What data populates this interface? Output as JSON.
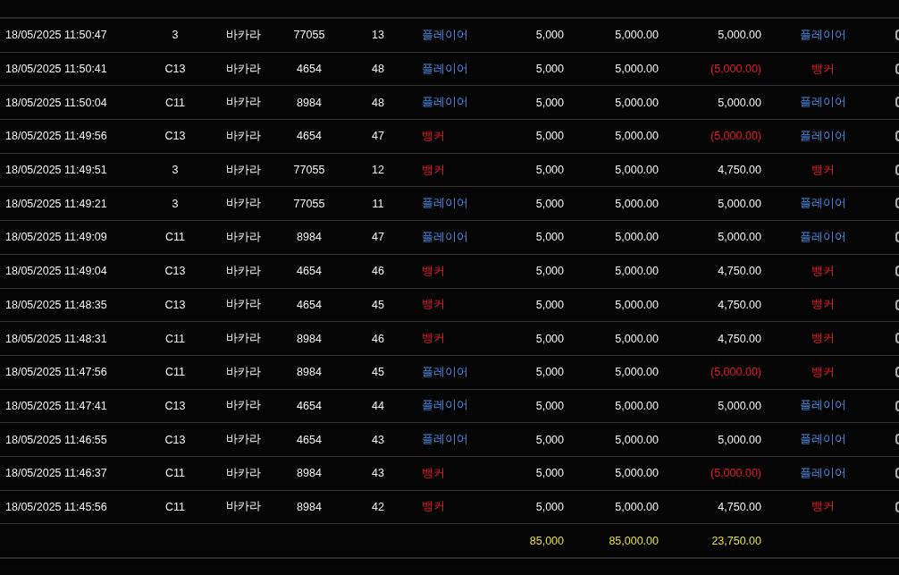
{
  "rows": [
    {
      "time": "18/05/2025 11:50:47",
      "table": "3",
      "game": "바카라",
      "round": "77055",
      "shoe": "13",
      "bet": {
        "text": "플레이어",
        "kind": "player"
      },
      "stake": "5,000",
      "valid": "5,000.00",
      "payout": "5,000.00",
      "loss": false,
      "result": {
        "text": "플레이어",
        "kind": "player"
      }
    },
    {
      "time": "18/05/2025 11:50:41",
      "table": "C13",
      "game": "바카라",
      "round": "4654",
      "shoe": "48",
      "bet": {
        "text": "플레이어",
        "kind": "player"
      },
      "stake": "5,000",
      "valid": "5,000.00",
      "payout": "(5,000.00)",
      "loss": true,
      "result": {
        "text": "뱅커",
        "kind": "banker"
      }
    },
    {
      "time": "18/05/2025 11:50:04",
      "table": "C11",
      "game": "바카라",
      "round": "8984",
      "shoe": "48",
      "bet": {
        "text": "플레이어",
        "kind": "player"
      },
      "stake": "5,000",
      "valid": "5,000.00",
      "payout": "5,000.00",
      "loss": false,
      "result": {
        "text": "플레이어",
        "kind": "player"
      }
    },
    {
      "time": "18/05/2025 11:49:56",
      "table": "C13",
      "game": "바카라",
      "round": "4654",
      "shoe": "47",
      "bet": {
        "text": "뱅커",
        "kind": "banker"
      },
      "stake": "5,000",
      "valid": "5,000.00",
      "payout": "(5,000.00)",
      "loss": true,
      "result": {
        "text": "플레이어",
        "kind": "player"
      }
    },
    {
      "time": "18/05/2025 11:49:51",
      "table": "3",
      "game": "바카라",
      "round": "77055",
      "shoe": "12",
      "bet": {
        "text": "뱅커",
        "kind": "banker"
      },
      "stake": "5,000",
      "valid": "5,000.00",
      "payout": "4,750.00",
      "loss": false,
      "result": {
        "text": "뱅커",
        "kind": "banker"
      }
    },
    {
      "time": "18/05/2025 11:49:21",
      "table": "3",
      "game": "바카라",
      "round": "77055",
      "shoe": "11",
      "bet": {
        "text": "플레이어",
        "kind": "player"
      },
      "stake": "5,000",
      "valid": "5,000.00",
      "payout": "5,000.00",
      "loss": false,
      "result": {
        "text": "플레이어",
        "kind": "player"
      }
    },
    {
      "time": "18/05/2025 11:49:09",
      "table": "C11",
      "game": "바카라",
      "round": "8984",
      "shoe": "47",
      "bet": {
        "text": "플레이어",
        "kind": "player"
      },
      "stake": "5,000",
      "valid": "5,000.00",
      "payout": "5,000.00",
      "loss": false,
      "result": {
        "text": "플레이어",
        "kind": "player"
      }
    },
    {
      "time": "18/05/2025 11:49:04",
      "table": "C13",
      "game": "바카라",
      "round": "4654",
      "shoe": "46",
      "bet": {
        "text": "뱅커",
        "kind": "banker"
      },
      "stake": "5,000",
      "valid": "5,000.00",
      "payout": "4,750.00",
      "loss": false,
      "result": {
        "text": "뱅커",
        "kind": "banker"
      }
    },
    {
      "time": "18/05/2025 11:48:35",
      "table": "C13",
      "game": "바카라",
      "round": "4654",
      "shoe": "45",
      "bet": {
        "text": "뱅커",
        "kind": "banker"
      },
      "stake": "5,000",
      "valid": "5,000.00",
      "payout": "4,750.00",
      "loss": false,
      "result": {
        "text": "뱅커",
        "kind": "banker"
      }
    },
    {
      "time": "18/05/2025 11:48:31",
      "table": "C11",
      "game": "바카라",
      "round": "8984",
      "shoe": "46",
      "bet": {
        "text": "뱅커",
        "kind": "banker"
      },
      "stake": "5,000",
      "valid": "5,000.00",
      "payout": "4,750.00",
      "loss": false,
      "result": {
        "text": "뱅커",
        "kind": "banker"
      }
    },
    {
      "time": "18/05/2025 11:47:56",
      "table": "C11",
      "game": "바카라",
      "round": "8984",
      "shoe": "45",
      "bet": {
        "text": "플레이어",
        "kind": "player"
      },
      "stake": "5,000",
      "valid": "5,000.00",
      "payout": "(5,000.00)",
      "loss": true,
      "result": {
        "text": "뱅커",
        "kind": "banker"
      }
    },
    {
      "time": "18/05/2025 11:47:41",
      "table": "C13",
      "game": "바카라",
      "round": "4654",
      "shoe": "44",
      "bet": {
        "text": "플레이어",
        "kind": "player"
      },
      "stake": "5,000",
      "valid": "5,000.00",
      "payout": "5,000.00",
      "loss": false,
      "result": {
        "text": "플레이어",
        "kind": "player"
      }
    },
    {
      "time": "18/05/2025 11:46:55",
      "table": "C13",
      "game": "바카라",
      "round": "4654",
      "shoe": "43",
      "bet": {
        "text": "플레이어",
        "kind": "player"
      },
      "stake": "5,000",
      "valid": "5,000.00",
      "payout": "5,000.00",
      "loss": false,
      "result": {
        "text": "플레이어",
        "kind": "player"
      }
    },
    {
      "time": "18/05/2025 11:46:37",
      "table": "C11",
      "game": "바카라",
      "round": "8984",
      "shoe": "43",
      "bet": {
        "text": "뱅커",
        "kind": "banker"
      },
      "stake": "5,000",
      "valid": "5,000.00",
      "payout": "(5,000.00)",
      "loss": true,
      "result": {
        "text": "플레이어",
        "kind": "player"
      }
    },
    {
      "time": "18/05/2025 11:45:56",
      "table": "C11",
      "game": "바카라",
      "round": "8984",
      "shoe": "42",
      "bet": {
        "text": "뱅커",
        "kind": "banker"
      },
      "stake": "5,000",
      "valid": "5,000.00",
      "payout": "4,750.00",
      "loss": false,
      "result": {
        "text": "뱅커",
        "kind": "banker"
      }
    }
  ],
  "totals": {
    "stake": "85,000",
    "valid": "85,000.00",
    "payout": "23,750.00"
  }
}
